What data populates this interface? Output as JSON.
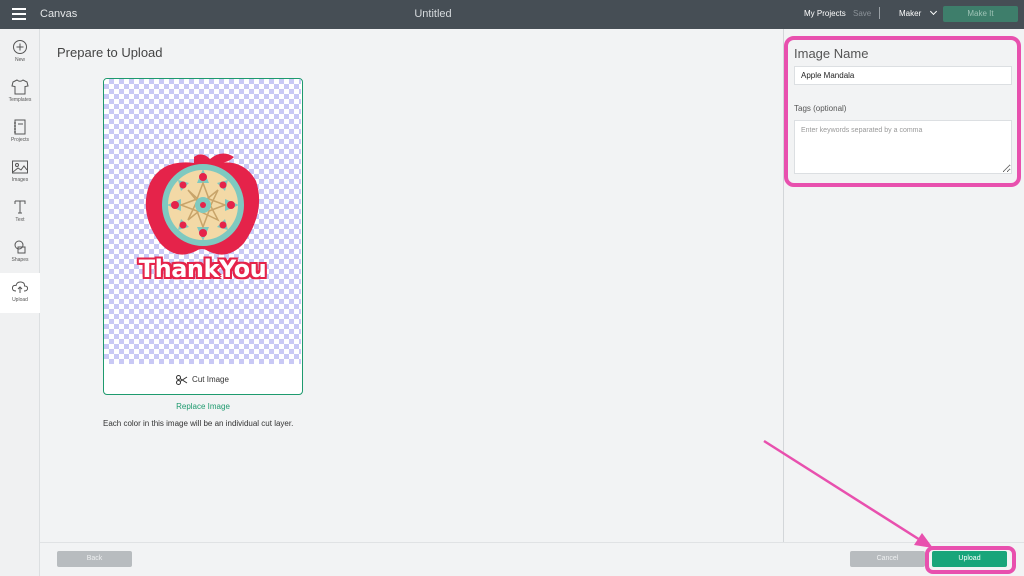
{
  "topbar": {
    "app_title": "Canvas",
    "doc_title": "Untitled",
    "my_projects": "My Projects",
    "save": "Save",
    "machine": "Maker",
    "make_it": "Make It"
  },
  "sidebar": {
    "items": [
      {
        "label": "New",
        "icon": "plus-circle-icon"
      },
      {
        "label": "Templates",
        "icon": "tshirt-icon"
      },
      {
        "label": "Projects",
        "icon": "notebook-icon"
      },
      {
        "label": "Images",
        "icon": "image-icon"
      },
      {
        "label": "Text",
        "icon": "text-icon"
      },
      {
        "label": "Shapes",
        "icon": "shapes-icon"
      },
      {
        "label": "Upload",
        "icon": "cloud-upload-icon",
        "active": true
      }
    ]
  },
  "main": {
    "title": "Prepare to Upload",
    "preview_text": "ThankYou",
    "cut_label": "Cut Image",
    "replace_label": "Replace Image",
    "note": "Each color in this image will be an individual cut layer."
  },
  "form": {
    "name_label": "Image Name",
    "name_value": "Apple Mandala",
    "tags_label": "Tags (optional)",
    "tags_placeholder": "Enter keywords separated by a comma"
  },
  "footer": {
    "back": "Back",
    "cancel": "Cancel",
    "upload": "Upload"
  },
  "colors": {
    "accent": "#1e9a6e",
    "highlight": "#e850ae",
    "topbar": "#464e55"
  }
}
